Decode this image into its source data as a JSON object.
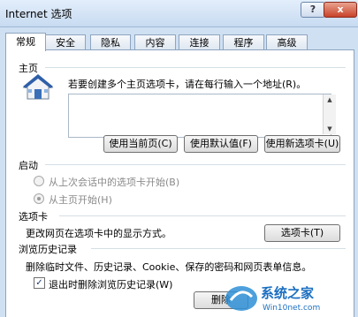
{
  "window": {
    "title": "Internet 选项",
    "help_label": "?",
    "close_label": "x"
  },
  "tabs": [
    {
      "label": "常规",
      "active": true
    },
    {
      "label": "安全",
      "active": false
    },
    {
      "label": "隐私",
      "active": false
    },
    {
      "label": "内容",
      "active": false
    },
    {
      "label": "连接",
      "active": false
    },
    {
      "label": "程序",
      "active": false
    },
    {
      "label": "高级",
      "active": false
    }
  ],
  "homepage": {
    "heading": "主页",
    "instruction": "若要创建多个主页选项卡，请在每行输入一个地址(R)。",
    "address_value": "",
    "buttons": {
      "use_current": "使用当前页(C)",
      "use_default": "使用默认值(F)",
      "use_new_tab": "使用新选项卡(U)"
    }
  },
  "startup": {
    "heading": "启动",
    "option_last_session": "从上次会话中的选项卡开始(B)",
    "option_homepage": "从主页开始(H)",
    "selected": "homepage"
  },
  "tabs_section": {
    "heading": "选项卡",
    "description": "更改网页在选项卡中的显示方式。",
    "button": "选项卡(T)"
  },
  "history": {
    "heading": "浏览历史记录",
    "description": "删除临时文件、历史记录、Cookie、保存的密码和网页表单信息。",
    "checkbox_label": "退出时删除浏览历史记录(W)",
    "checkbox_checked": true,
    "check_mark": "✓",
    "delete_button": "删除"
  },
  "watermark": {
    "name": "系统之家",
    "url": "Win10net.com"
  },
  "colors": {
    "frame": "#cfe0f2",
    "close_button": "#c9432a",
    "panel": "#ffffff"
  }
}
